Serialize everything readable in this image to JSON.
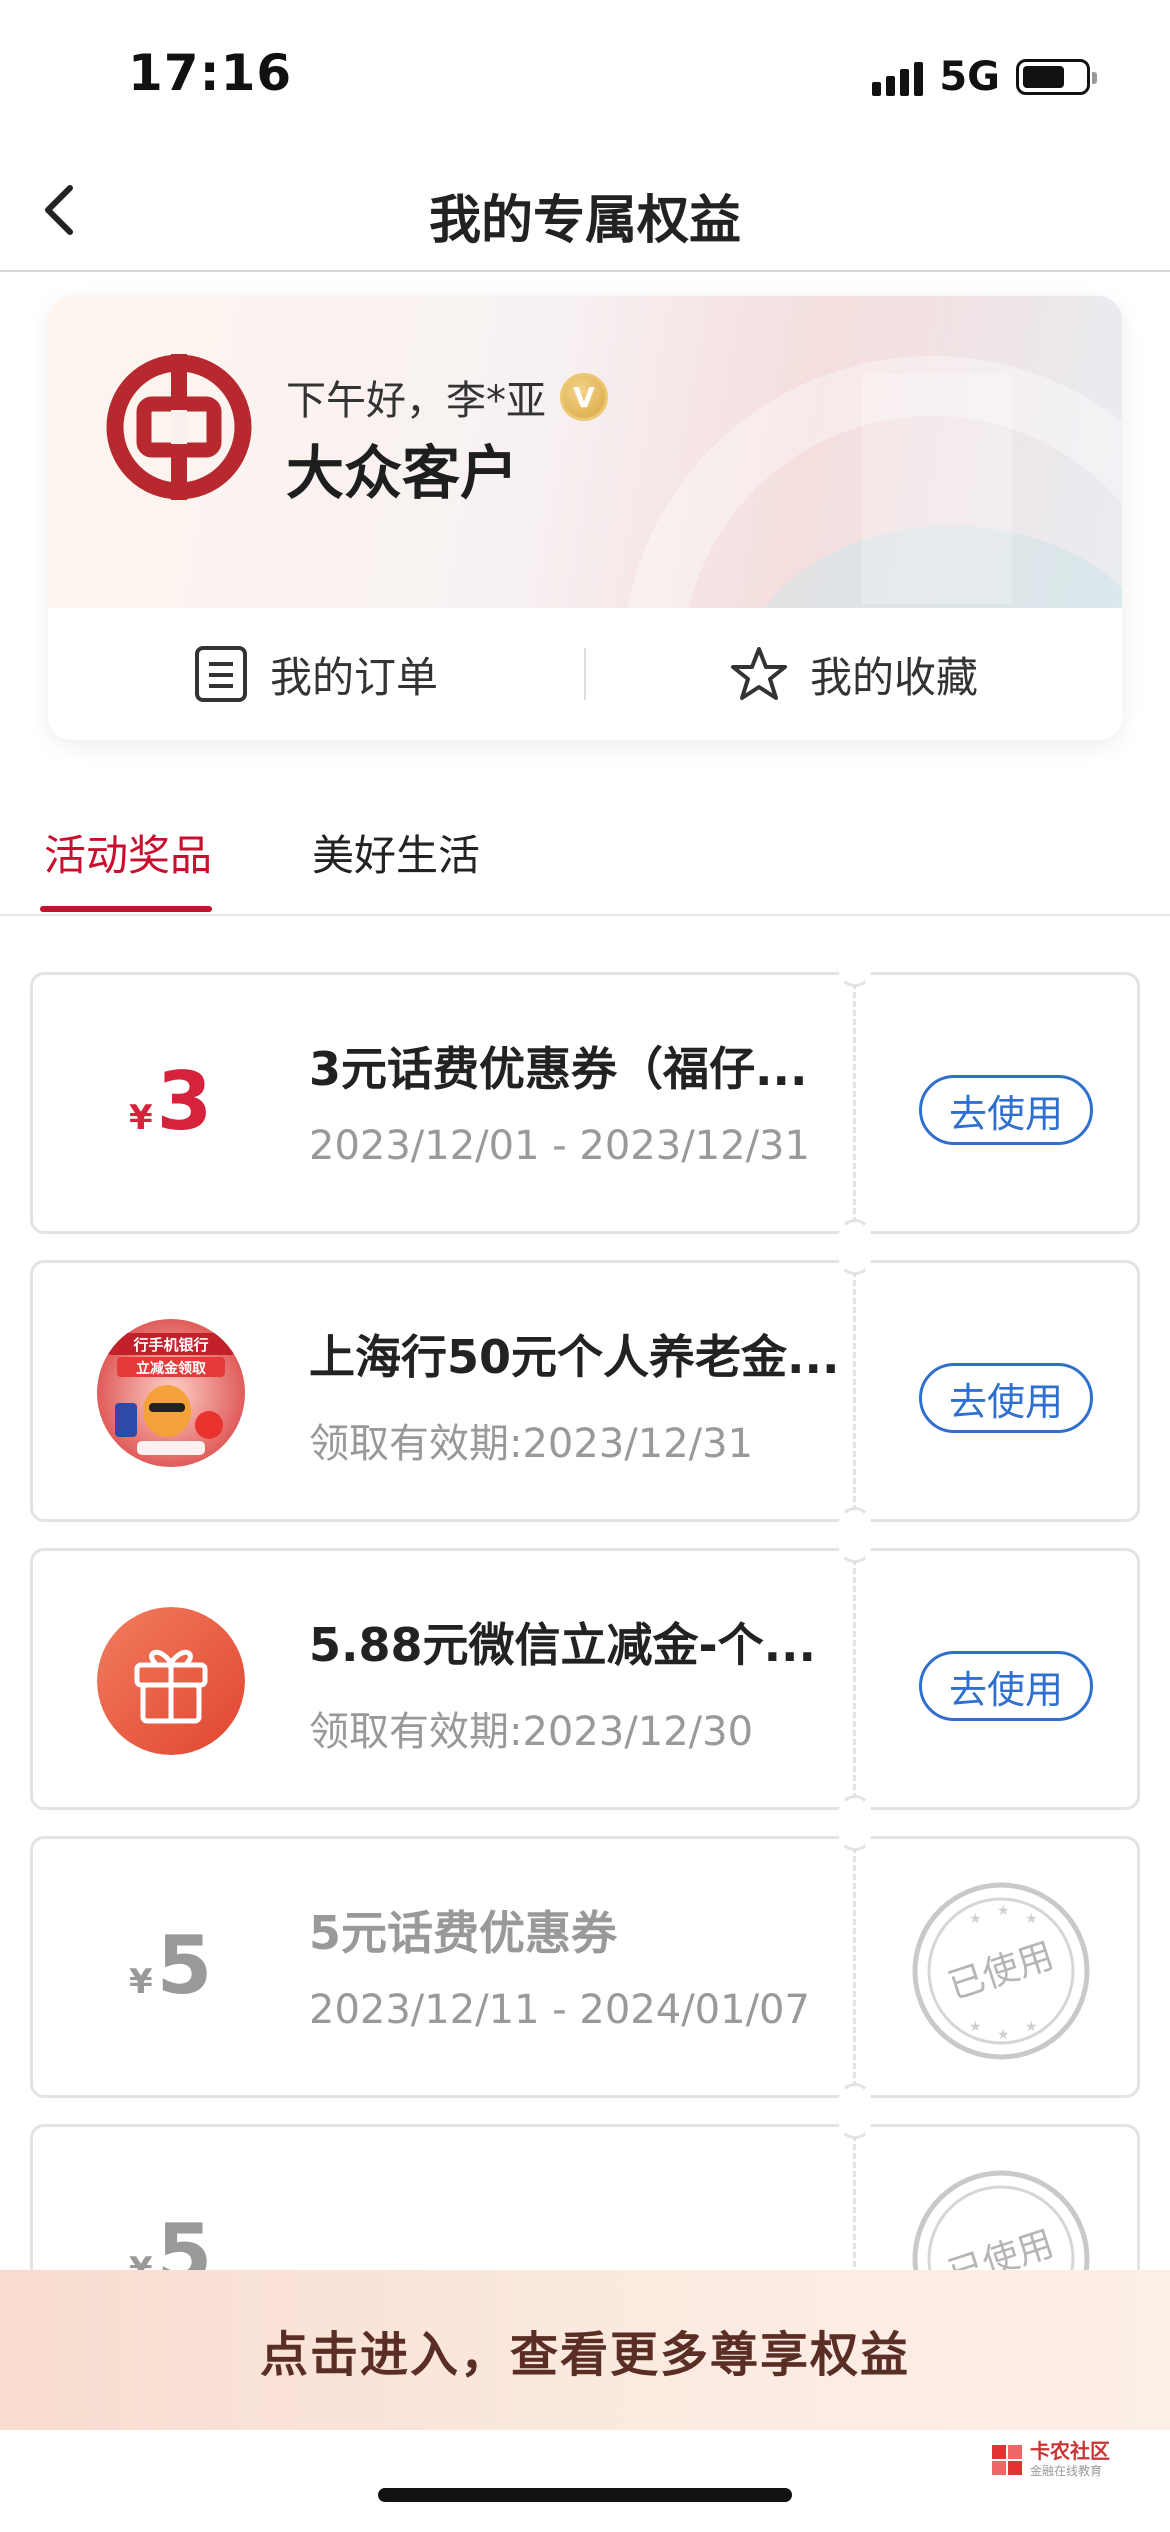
{
  "status_bar": {
    "time": "17:16",
    "network": "5G"
  },
  "nav": {
    "title": "我的专属权益"
  },
  "profile": {
    "greeting": "下午好，李*亚",
    "vip_badge": "V",
    "level": "大众客户",
    "actions": [
      {
        "label": "我的订单",
        "icon": "order-list-icon"
      },
      {
        "label": "我的收藏",
        "icon": "star-icon"
      }
    ]
  },
  "tabs": [
    {
      "label": "活动奖品",
      "active": true
    },
    {
      "label": "美好生活",
      "active": false
    }
  ],
  "coupons": [
    {
      "type": "amount",
      "currency": "¥",
      "amount": "3",
      "title": "3元话费优惠券（福仔...",
      "date": "2023/12/01 - 2023/12/31",
      "action": "去使用",
      "status": "active"
    },
    {
      "type": "image",
      "title": "上海行50元个人养老金...",
      "date": "领取有效期:2023/12/31",
      "action": "去使用",
      "status": "active",
      "thumb_text": [
        "行手机银行",
        "立减金领取"
      ]
    },
    {
      "type": "gift",
      "title": "5.88元微信立减金-个...",
      "date": "领取有效期:2023/12/30",
      "action": "去使用",
      "status": "active"
    },
    {
      "type": "amount",
      "currency": "¥",
      "amount": "5",
      "title": "5元话费优惠券",
      "date": "2023/12/11 - 2024/01/07",
      "stamp": "已使用",
      "status": "used"
    },
    {
      "type": "amount",
      "currency": "¥",
      "amount": "5",
      "title": "",
      "date": "",
      "stamp": "已使用",
      "status": "used"
    }
  ],
  "banner": {
    "text": "点击进入，查看更多尊享权益"
  },
  "watermark": {
    "text": "卡农社区",
    "sub": "金融在线教育"
  },
  "colors": {
    "brand_red": "#c8102e",
    "link_blue": "#2f6fcf",
    "muted": "#999999"
  }
}
